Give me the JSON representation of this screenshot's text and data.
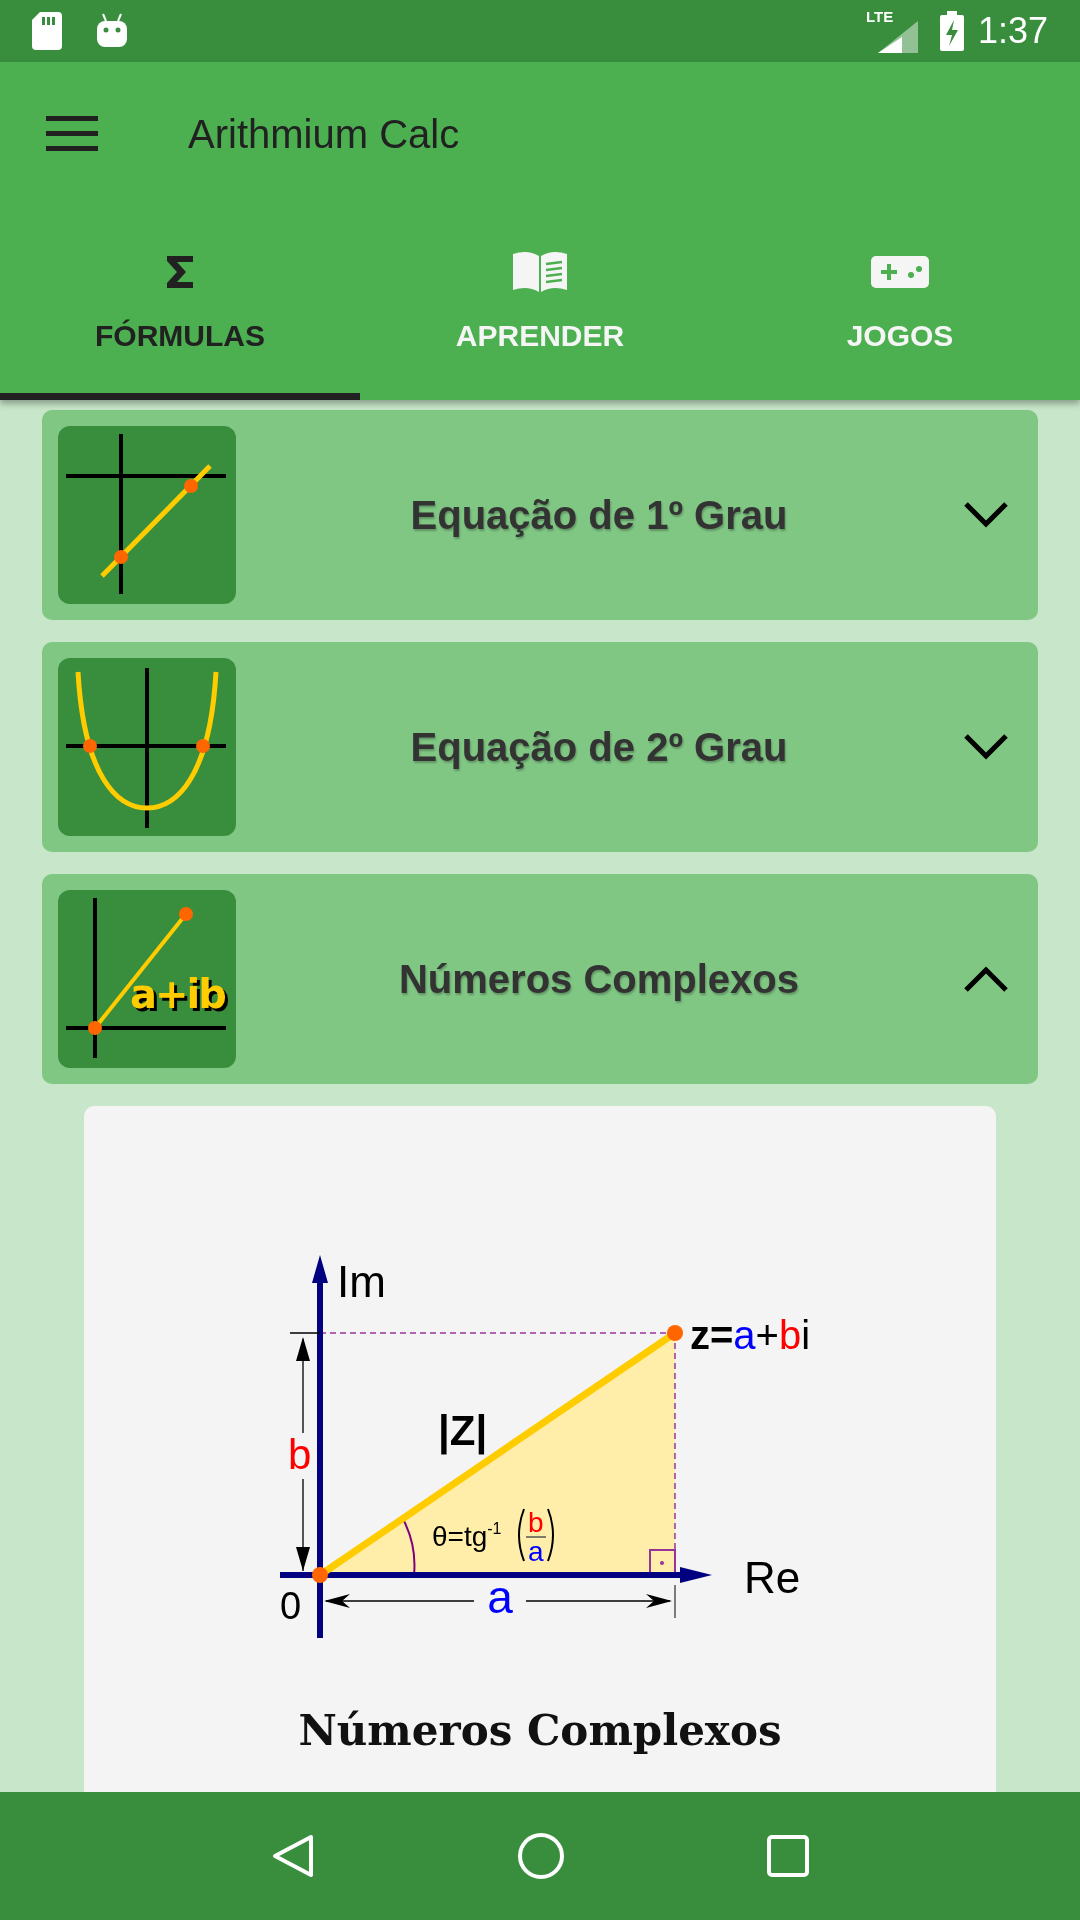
{
  "status_bar": {
    "network": "LTE",
    "time": "1:37"
  },
  "toolbar": {
    "title": "Arithmium Calc"
  },
  "tabs": [
    {
      "label": "FÓRMULAS",
      "selected": true
    },
    {
      "label": "APRENDER",
      "selected": false
    },
    {
      "label": "JOGOS",
      "selected": false
    }
  ],
  "formulas": [
    {
      "title": "Equação de 1º Grau",
      "kind": "line",
      "expanded": false
    },
    {
      "title": "Equação de 2º Grau",
      "kind": "parabola",
      "expanded": false
    },
    {
      "title": "Números Complexos",
      "kind": "complex",
      "icon_text": "a+ib",
      "expanded": true
    }
  ],
  "detail": {
    "diagram": {
      "axis_y": "Im",
      "axis_x": "Re",
      "origin": "0",
      "side_b": "b",
      "side_a": "a",
      "modulus": "|Z|",
      "point_label": [
        {
          "text": "z=",
          "color": "#000000"
        },
        {
          "text": "a",
          "color": "#0000ff"
        },
        {
          "text": "+",
          "color": "#000000"
        },
        {
          "text": "b",
          "color": "#ff0000"
        },
        {
          "text": "i",
          "color": "#000000"
        }
      ],
      "angle": {
        "text": "θ=tg",
        "exponent": "-1",
        "numerator": "b",
        "denominator": "a"
      }
    },
    "title": "Números Complexos"
  }
}
